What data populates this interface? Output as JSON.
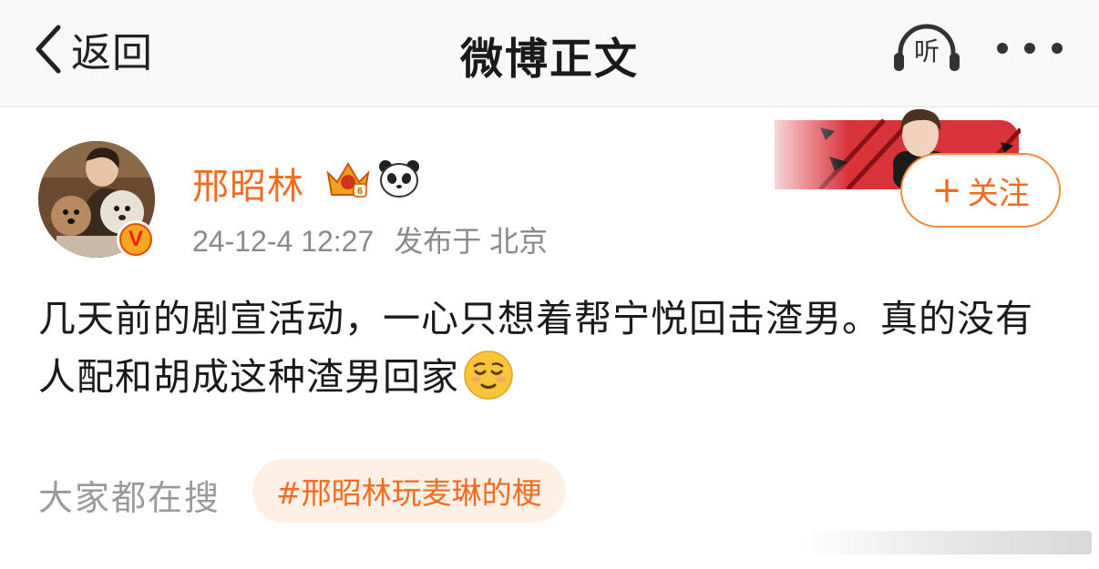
{
  "nav": {
    "back_label": "返回",
    "title": "微博正文",
    "listen_label": "听"
  },
  "user": {
    "name": "邢昭林",
    "verified_mark": "V",
    "timestamp": "24-12-4 12:27",
    "location": "发布于 北京",
    "follow_label": "关注",
    "follow_plus": "+"
  },
  "post": {
    "text": "几天前的剧宣活动，一心只想着帮宁悦回击渣男。真的没有人配和胡成这种渣男回家",
    "emoji": "relieved-face-icon"
  },
  "hot_search": {
    "label": "大家都在搜",
    "topic": "#邢昭林玩麦琳的梗"
  },
  "colors": {
    "accent": "#f36c22",
    "pill_bg": "#fef0e4",
    "nav_bg": "#f8f8f8",
    "meta": "#8a8a8a"
  }
}
